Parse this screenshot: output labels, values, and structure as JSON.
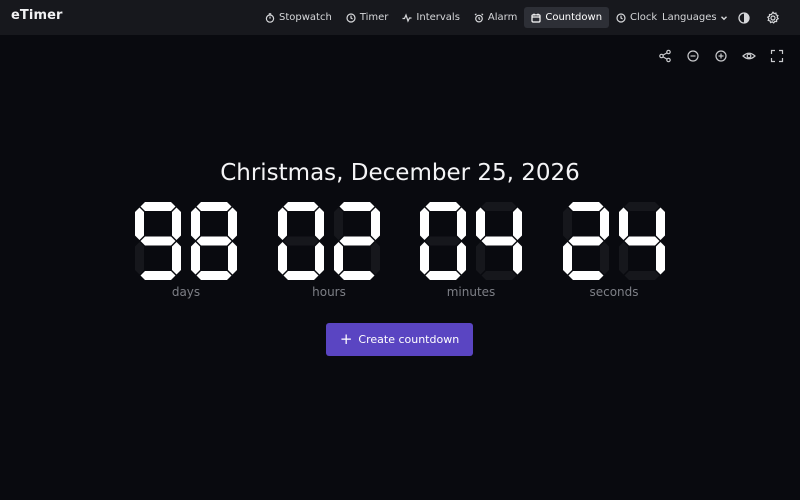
{
  "app": {
    "logo": "eTimer"
  },
  "nav": [
    {
      "id": "stopwatch",
      "label": "Stopwatch",
      "icon": "stopwatch-icon",
      "active": false
    },
    {
      "id": "timer",
      "label": "Timer",
      "icon": "timer-icon",
      "active": false
    },
    {
      "id": "intervals",
      "label": "Intervals",
      "icon": "pulse-icon",
      "active": false
    },
    {
      "id": "alarm",
      "label": "Alarm",
      "icon": "alarm-clock-icon",
      "active": false
    },
    {
      "id": "countdown",
      "label": "Countdown",
      "icon": "calendar-icon",
      "active": true
    },
    {
      "id": "clock",
      "label": "Clock",
      "icon": "clock-icon",
      "active": false
    }
  ],
  "languages": {
    "label": "Languages"
  },
  "countdown": {
    "title": "Christmas, December 25, 2026",
    "units": [
      {
        "value": "98",
        "label": "days"
      },
      {
        "value": "02",
        "label": "hours"
      },
      {
        "value": "04",
        "label": "minutes"
      },
      {
        "value": "24",
        "label": "seconds"
      }
    ]
  },
  "cta": {
    "label": "Create countdown"
  },
  "colors": {
    "background": "#090a0f",
    "topbar": "#17181d",
    "accent": "#5a45c2",
    "digit_on": "#ffffff",
    "digit_off": "#16171c"
  }
}
